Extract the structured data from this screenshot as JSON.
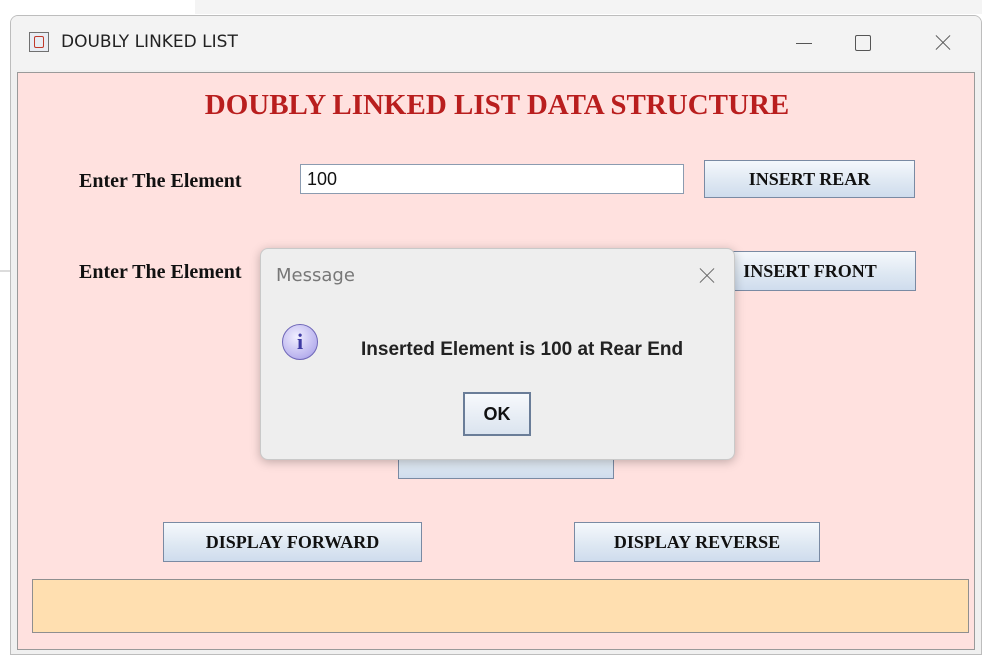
{
  "window": {
    "title": "DOUBLY LINKED LIST"
  },
  "main": {
    "heading": "DOUBLY LINKED LIST DATA STRUCTURE",
    "row1": {
      "label": "Enter The Element",
      "input_value": "100",
      "button": "INSERT REAR"
    },
    "row2": {
      "label": "Enter The Element",
      "button": "INSERT FRONT"
    },
    "buttons": {
      "display_forward": "DISPLAY FORWARD",
      "display_reverse": "DISPLAY REVERSE"
    },
    "status_text": ""
  },
  "dialog": {
    "title": "Message",
    "icon": "info-icon",
    "icon_glyph": "i",
    "message": "Inserted Element is 100 at Rear End",
    "ok_label": "OK"
  }
}
